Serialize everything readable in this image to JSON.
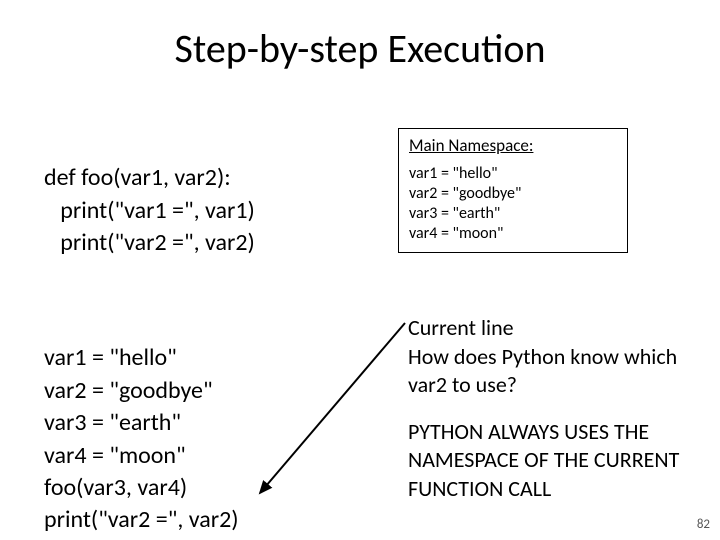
{
  "title": "Step-by-step Execution",
  "code_top": {
    "l1": "def foo(var1, var2):",
    "l2": "   print(\"var1 =\", var1)",
    "l3": "   print(\"var2 =\", var2)"
  },
  "code_bottom": {
    "l1": "var1 = \"hello\"",
    "l2": "var2 = \"goodbye\"",
    "l3": "var3 = \"earth\"",
    "l4": "var4 = \"moon\"",
    "l5": "foo(var3, var4)",
    "l6": "print(\"var2 =\", var2)"
  },
  "namespace": {
    "title": "Main Namespace:",
    "lines": [
      "var1 = \"hello\"",
      "var2 = \"goodbye\"",
      "var3 = \"earth\"",
      "var4 = \"moon\""
    ]
  },
  "commentary": {
    "current": "Current line",
    "question": "How does Python know which var2 to use?",
    "answer": "PYTHON ALWAYS USES THE NAMESPACE OF THE CURRENT FUNCTION CALL"
  },
  "page_number": "82"
}
